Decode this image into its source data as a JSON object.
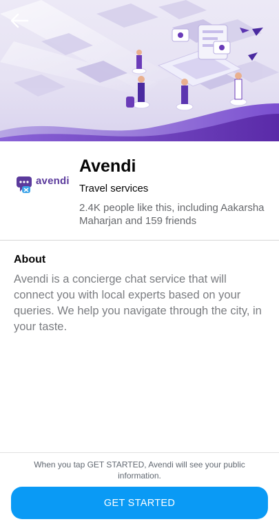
{
  "icons": {
    "back": "back-arrow-icon",
    "logo": "avendi-logo-icon"
  },
  "colors": {
    "accent": "#0a9af5",
    "brand": "#5b3a9c",
    "hero_wave": "#6a3bb8"
  },
  "page": {
    "logo_text": "avendi",
    "name": "Avendi",
    "category": "Travel services",
    "likes": "2.4K people like this, including Aakarsha Maharjan and 159 friends"
  },
  "about": {
    "heading": "About",
    "body": "Avendi is a concierge chat service that will connect you with local experts based on your queries. We help you navigate through the city, in your taste."
  },
  "footer": {
    "consent": "When you tap GET STARTED, Avendi will see your public information.",
    "button_label": "GET STARTED"
  }
}
